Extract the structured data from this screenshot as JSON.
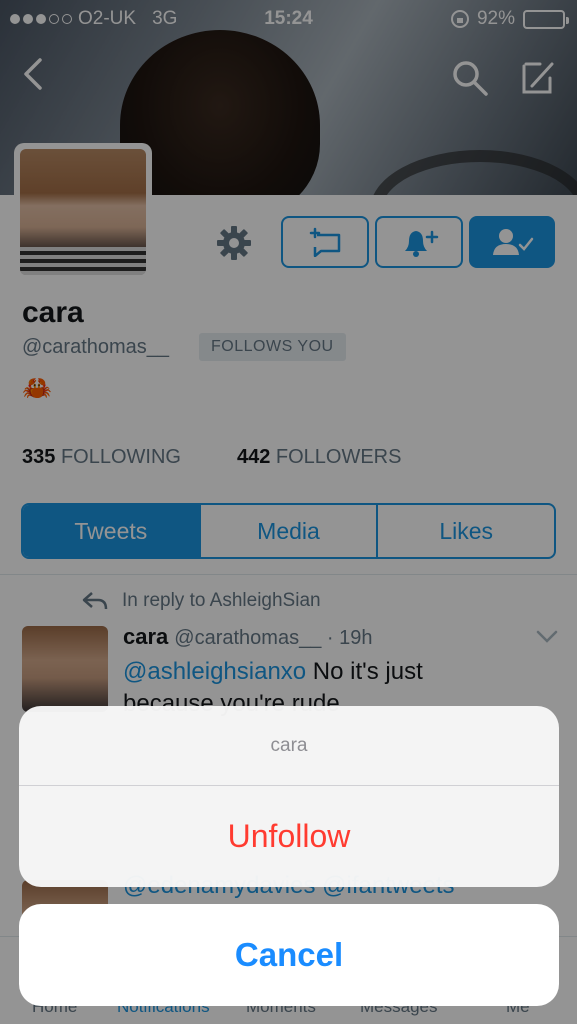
{
  "status_bar": {
    "carrier": "O2-UK",
    "network": "3G",
    "time": "15:24",
    "battery_percent": "92%",
    "battery_level": 0.92,
    "signal_bars_filled": 3,
    "signal_bars_total": 5
  },
  "header": {
    "back_icon": "chevron-left-icon",
    "search_icon": "search-icon",
    "compose_icon": "compose-icon"
  },
  "profile": {
    "name": "cara",
    "handle": "@carathomas__",
    "follows_you_badge": "FOLLOWS YOU",
    "bio_emoji": "🦀",
    "following_count": "335",
    "following_label": "FOLLOWING",
    "followers_count": "442",
    "followers_label": "FOLLOWERS"
  },
  "profile_actions": {
    "settings_icon": "gear-icon",
    "message_icon": "direct-message-icon",
    "notifications_icon": "bell-plus-icon",
    "following_icon": "person-check-icon"
  },
  "tabs": [
    {
      "label": "Tweets",
      "active": true
    },
    {
      "label": "Media",
      "active": false
    },
    {
      "label": "Likes",
      "active": false
    }
  ],
  "tweet": {
    "reply_context": "In reply to AshleighSian",
    "author": "cara",
    "handle": "@carathomas__",
    "time": "· 19h",
    "mention": "@ashleighsianxo",
    "text": " No it's just",
    "text_line2": "because you're rude"
  },
  "tweet2": {
    "text": "@edenamydavies @ifantweets"
  },
  "bottom_tabs": [
    {
      "label": "Home",
      "active": false
    },
    {
      "label": "Notifications",
      "active": true
    },
    {
      "label": "Moments",
      "active": false
    },
    {
      "label": "Messages",
      "active": false
    },
    {
      "label": "Me",
      "active": false
    }
  ],
  "action_sheet": {
    "title": "cara",
    "destructive_action": "Unfollow",
    "cancel": "Cancel"
  },
  "colors": {
    "accent": "#1b95e0",
    "destructive": "#ff3b30",
    "ios_blue": "#1a8cff"
  }
}
